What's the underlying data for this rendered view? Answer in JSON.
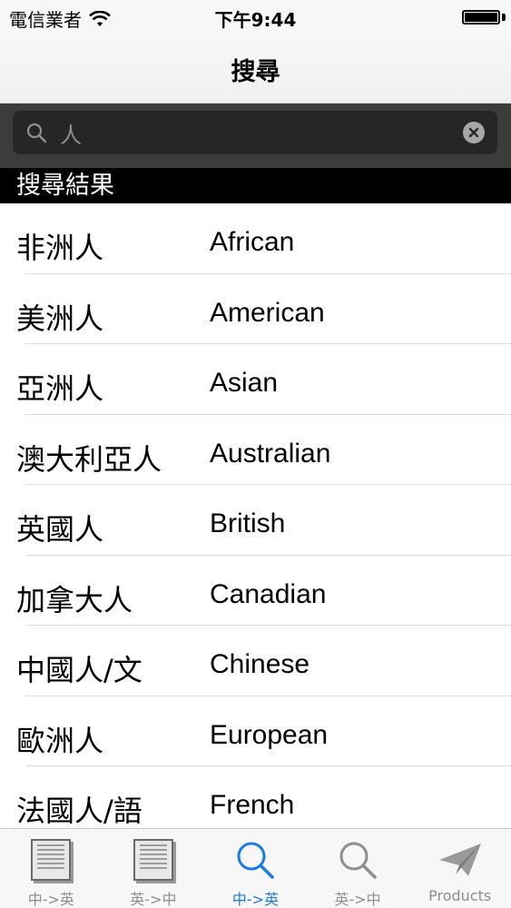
{
  "status_bar": {
    "carrier": "電信業者",
    "time": "下午9:44"
  },
  "nav": {
    "title": "搜尋"
  },
  "search": {
    "value": "人",
    "placeholder": ""
  },
  "section": {
    "header": "搜尋結果"
  },
  "results": [
    {
      "zh": "非洲人",
      "en": "African"
    },
    {
      "zh": "美洲人",
      "en": "American"
    },
    {
      "zh": "亞洲人",
      "en": "Asian"
    },
    {
      "zh": "澳大利亞人",
      "en": "Australian"
    },
    {
      "zh": "英國人",
      "en": "British"
    },
    {
      "zh": "加拿大人",
      "en": "Canadian"
    },
    {
      "zh": "中國人/文",
      "en": "Chinese"
    },
    {
      "zh": "歐洲人",
      "en": "European"
    },
    {
      "zh": "法國人/語",
      "en": "French"
    }
  ],
  "tabs": [
    {
      "label": "中->英",
      "icon": "book-icon",
      "active": false
    },
    {
      "label": "英->中",
      "icon": "book-icon",
      "active": false
    },
    {
      "label": "中->英",
      "icon": "search-icon",
      "active": true
    },
    {
      "label": "英->中",
      "icon": "search-icon",
      "active": false
    },
    {
      "label": "Products",
      "icon": "paper-plane-icon",
      "active": false
    }
  ],
  "colors": {
    "accent": "#1a7be6",
    "inactive": "#8e8e8e",
    "search_bar_bg": "#3c3d3a",
    "section_header_bg": "#000000"
  }
}
